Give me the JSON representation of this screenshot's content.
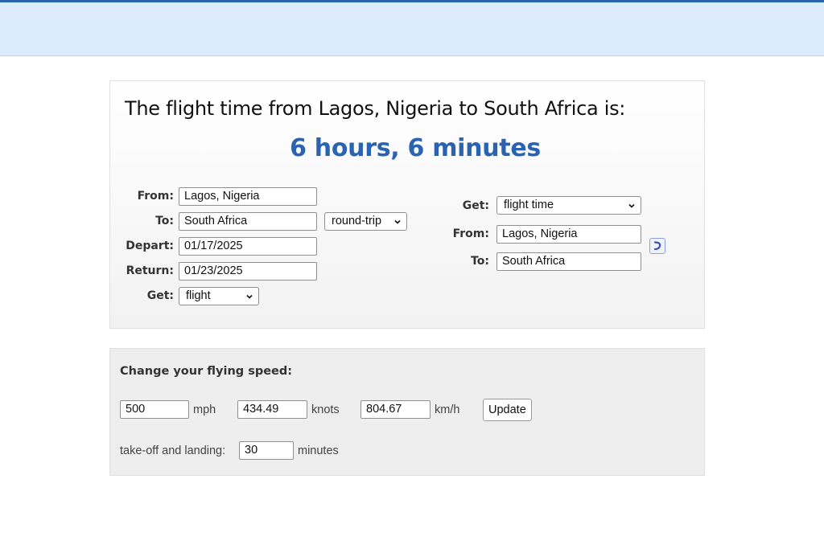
{
  "result": {
    "title": "The flight time from Lagos, Nigeria to South Africa is:",
    "value": "6 hours, 6 minutes",
    "accent_color": "#2a63b0"
  },
  "left_form": {
    "from_label": "From:",
    "from_value": "Lagos, Nigeria",
    "to_label": "To:",
    "to_value": "South Africa",
    "trip_type": "round-trip",
    "depart_label": "Depart:",
    "depart_value": "01/17/2025",
    "return_label": "Return:",
    "return_value": "01/23/2025",
    "get_label": "Get:",
    "get_value": "flight"
  },
  "right_form": {
    "get_label": "Get:",
    "get_value": "flight time",
    "from_label": "From:",
    "from_value": "Lagos, Nigeria",
    "to_label": "To:",
    "to_value": "South Africa",
    "swap_icon": "swap-arrow-icon"
  },
  "speed": {
    "title": "Change your flying speed:",
    "mph_value": "500",
    "mph_unit": "mph",
    "knots_value": "434.49",
    "knots_unit": "knots",
    "kmh_value": "804.67",
    "kmh_unit": "km/h",
    "update_label": "Update",
    "takeoff_label": "take-off and landing:",
    "takeoff_value": "30",
    "takeoff_unit": "minutes"
  }
}
